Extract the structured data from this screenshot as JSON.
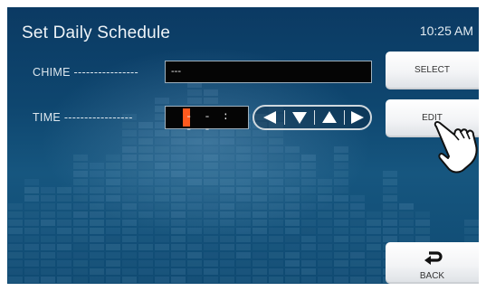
{
  "header": {
    "title": "Set Daily Schedule",
    "clock": "10:25 AM"
  },
  "chime": {
    "label": "CHIME ----------------",
    "value": "---"
  },
  "time": {
    "label": "TIME -----------------",
    "value": "- - : - -"
  },
  "arrows": [
    {
      "direction": "left",
      "icon": "arrow-left-icon"
    },
    {
      "direction": "down",
      "icon": "arrow-down-icon"
    },
    {
      "direction": "up",
      "icon": "arrow-up-icon"
    },
    {
      "direction": "right",
      "icon": "arrow-right-icon"
    }
  ],
  "buttons": {
    "select": "SELECT",
    "edit": "EDIT",
    "back": "BACK"
  },
  "icons": {
    "back": "return-arrow-icon",
    "pointer": "pointing-hand-icon"
  },
  "colors": {
    "accent": "#ff5a1e",
    "background": "#0e466f",
    "button": "#f3f4f6"
  }
}
